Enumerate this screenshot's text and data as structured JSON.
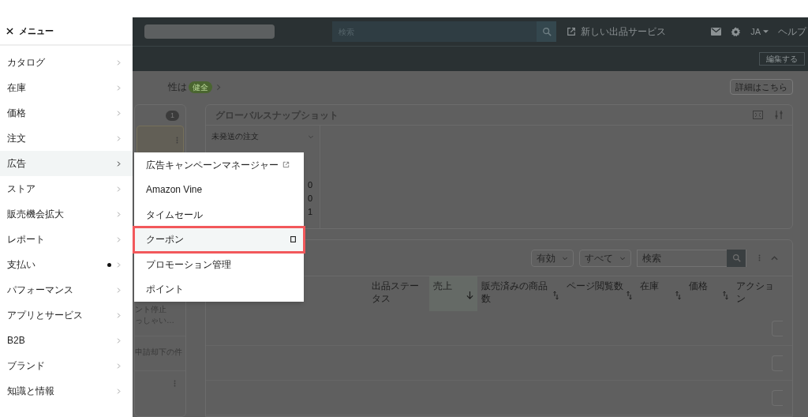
{
  "header": {
    "search": {
      "placeholder": "検索"
    },
    "new_listing_link": "新しい出品サービス",
    "language": "JA",
    "help": "ヘルプ"
  },
  "subheader": {
    "edit_button": "編集する"
  },
  "status_line": {
    "text": "性は",
    "badge": "健全"
  },
  "details_button": "詳細はこちら",
  "left_card": {
    "count": "1",
    "texts": [
      "ント停止",
      "っしゃい…",
      "申請却下の件"
    ]
  },
  "snapshot": {
    "title": "グローバルスナップショット",
    "metric": "未発送の注文",
    "values": [
      "0",
      "0",
      "1"
    ]
  },
  "listings": {
    "filters": [
      "有効",
      "すべて"
    ],
    "search": {
      "placeholder": "検索"
    },
    "columns": [
      {
        "label": "出品ステータス",
        "sortable": false,
        "sorted": false
      },
      {
        "label": "売上",
        "sortable": true,
        "sorted": true
      },
      {
        "label": "販売済みの商品数",
        "sortable": true,
        "sorted": false
      },
      {
        "label": "ページ閲覧数",
        "sortable": true,
        "sorted": false
      },
      {
        "label": "在庫",
        "sortable": true,
        "sorted": false
      },
      {
        "label": "価格",
        "sortable": true,
        "sorted": false
      },
      {
        "label": "アクション",
        "sortable": false,
        "sorted": false
      }
    ]
  },
  "menu": {
    "title": "メニュー",
    "items": [
      {
        "label": "カタログ",
        "selected": false,
        "dot": false
      },
      {
        "label": "在庫",
        "selected": false,
        "dot": false
      },
      {
        "label": "価格",
        "selected": false,
        "dot": false
      },
      {
        "label": "注文",
        "selected": false,
        "dot": false
      },
      {
        "label": "広告",
        "selected": true,
        "dot": false
      },
      {
        "label": "ストア",
        "selected": false,
        "dot": false
      },
      {
        "label": "販売機会拡大",
        "selected": false,
        "dot": false
      },
      {
        "label": "レポート",
        "selected": false,
        "dot": false
      },
      {
        "label": "支払い",
        "selected": false,
        "dot": true
      },
      {
        "label": "パフォーマンス",
        "selected": false,
        "dot": false
      },
      {
        "label": "アプリとサービス",
        "selected": false,
        "dot": false
      },
      {
        "label": "B2B",
        "selected": false,
        "dot": false
      },
      {
        "label": "ブランド",
        "selected": false,
        "dot": false
      },
      {
        "label": "知識と情報",
        "selected": false,
        "dot": false
      }
    ]
  },
  "submenu": {
    "items": [
      {
        "label": "広告キャンペーンマネージャー",
        "external": true,
        "selected": false
      },
      {
        "label": "Amazon Vine",
        "external": false,
        "selected": false
      },
      {
        "label": "タイムセール",
        "external": false,
        "selected": false
      },
      {
        "label": "クーポン",
        "external": false,
        "selected": true
      },
      {
        "label": "プロモーション管理",
        "external": false,
        "selected": false
      },
      {
        "label": "ポイント",
        "external": false,
        "selected": false
      }
    ]
  }
}
